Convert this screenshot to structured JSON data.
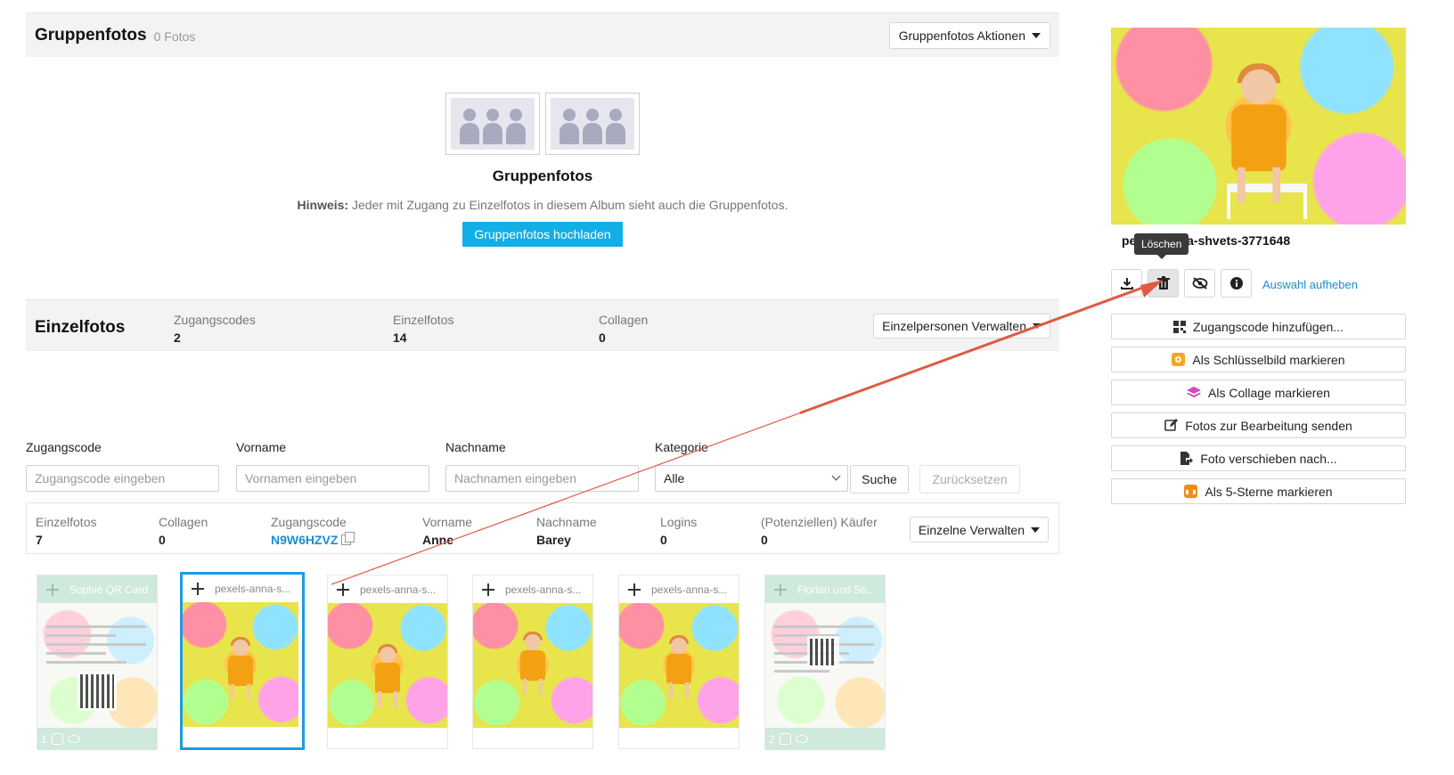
{
  "group": {
    "title": "Gruppenfotos",
    "count": "0 Fotos",
    "actions_label": "Gruppenfotos Aktionen",
    "empty_title": "Gruppenfotos",
    "hint_label": "Hinweis:",
    "hint_text": " Jeder mit Zugang zu Einzelfotos in diesem Album sieht auch die Gruppenfotos.",
    "upload_label": "Gruppenfotos hochladen"
  },
  "einzel": {
    "title": "Einzelfotos",
    "stats": [
      {
        "label": "Zugangscodes",
        "value": "2"
      },
      {
        "label": "Einzelfotos",
        "value": "14"
      },
      {
        "label": "Collagen",
        "value": "0"
      }
    ],
    "actions_label": "Einzelpersonen Verwalten"
  },
  "filters": {
    "code": {
      "label": "Zugangscode",
      "placeholder": "Zugangscode eingeben"
    },
    "first": {
      "label": "Vorname",
      "placeholder": "Vornamen eingeben"
    },
    "last": {
      "label": "Nachname",
      "placeholder": "Nachnamen eingeben"
    },
    "category": {
      "label": "Kategorie",
      "value": "Alle"
    },
    "search_label": "Suche",
    "reset_label": "Zurücksetzen"
  },
  "person": {
    "einzelfotos": {
      "label": "Einzelfotos",
      "value": "7"
    },
    "collagen": {
      "label": "Collagen",
      "value": "0"
    },
    "code": {
      "label": "Zugangscode",
      "value": "N9W6HZVZ"
    },
    "vorname": {
      "label": "Vorname",
      "value": "Anne"
    },
    "nachname": {
      "label": "Nachname",
      "value": "Barey"
    },
    "logins": {
      "label": "Logins",
      "value": "0"
    },
    "kaeufer": {
      "label": "(Potenziellen) Käufer",
      "value": "0"
    },
    "actions_label": "Einzelne Verwalten"
  },
  "thumbs": [
    {
      "name": "Sophie QR Card",
      "badge": "1"
    },
    {
      "name": "pexels-anna-s..."
    },
    {
      "name": "pexels-anna-s..."
    },
    {
      "name": "pexels-anna-s..."
    },
    {
      "name": "pexels-anna-s..."
    },
    {
      "name": "Florian und So...",
      "badge": "2"
    }
  ],
  "side": {
    "filename": "pexels-anna-shvets-3771648",
    "tooltip": "Löschen",
    "deselect_label": "Auswahl aufheben",
    "actions": [
      {
        "label": "Zugangscode hinzufügen...",
        "icon": "qr-icon",
        "color": "#333333"
      },
      {
        "label": "Als Schlüsselbild markieren",
        "icon": "keyframe-icon",
        "color": "#f5a623"
      },
      {
        "label": "Als Collage markieren",
        "icon": "layers-icon",
        "color": "#e040c8"
      },
      {
        "label": "Fotos zur Bearbeitung senden",
        "icon": "edit-icon",
        "color": "#333333"
      },
      {
        "label": "Foto verschieben nach...",
        "icon": "move-file-icon",
        "color": "#333333"
      },
      {
        "label": "Als 5-Sterne markieren",
        "icon": "stars-icon",
        "color": "#f08c1a"
      }
    ]
  },
  "colors": {
    "accent": "#12aee6",
    "link": "#1a8ed1",
    "selection": "#1a9be8",
    "annotation": "#e05a44"
  }
}
